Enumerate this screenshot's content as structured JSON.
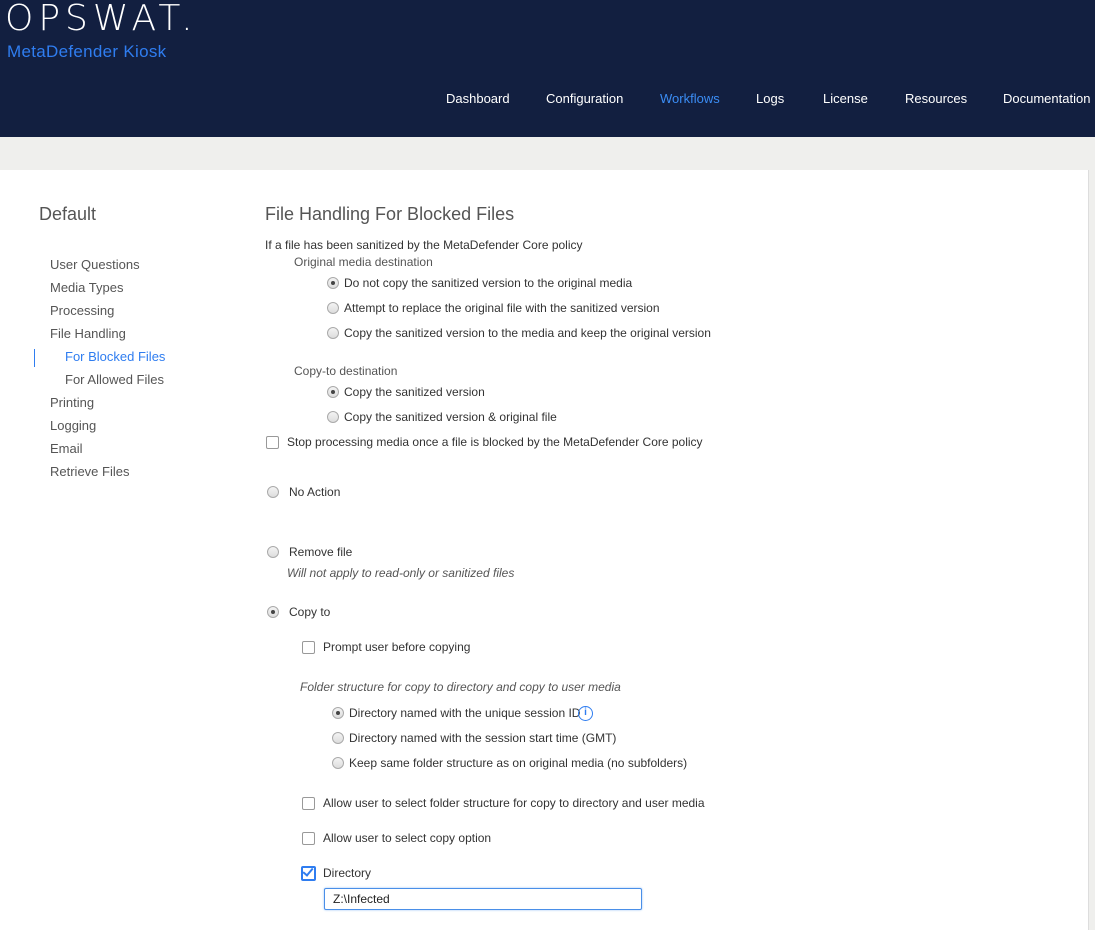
{
  "header": {
    "logo": "OPSWAT.",
    "product": "MetaDefender Kiosk",
    "nav": [
      "Dashboard",
      "Configuration",
      "Workflows",
      "Logs",
      "License",
      "Resources",
      "Documentation"
    ],
    "active_nav": "Workflows"
  },
  "sidebar": {
    "title": "Default",
    "items": [
      "User Questions",
      "Media Types",
      "Processing",
      "File Handling",
      "For Blocked Files",
      "For Allowed Files",
      "Printing",
      "Logging",
      "Email",
      "Retrieve Files"
    ],
    "active": "For Blocked Files"
  },
  "main": {
    "title": "File Handling For Blocked Files",
    "sanitized_intro": "If a file has been sanitized by the MetaDefender Core policy",
    "original_media_label": "Original media destination",
    "original_media_options": [
      "Do not copy the sanitized version to the original media",
      "Attempt to replace the original file with the sanitized version",
      "Copy the sanitized version to the media and keep the original version"
    ],
    "copy_to_label": "Copy-to destination",
    "copy_to_options": [
      "Copy the sanitized version",
      "Copy the sanitized version & original file"
    ],
    "stop_processing": "Stop processing media once a file is blocked by the MetaDefender Core policy",
    "no_action": "No Action",
    "remove_file": "Remove file",
    "remove_note": "Will not apply to read-only or sanitized files",
    "copy_to": "Copy to",
    "prompt_user": "Prompt user before copying",
    "folder_structure_label": "Folder structure for copy to directory and copy to user media",
    "folder_options": [
      "Directory named with the unique session ID",
      "Directory named with the session start time (GMT)",
      "Keep same folder structure as on original media (no subfolders)"
    ],
    "info_glyph": "i",
    "allow_folder": "Allow user to select folder structure for copy to directory and user media",
    "allow_copy_option": "Allow user to select copy option",
    "directory_label": "Directory",
    "directory_value": "Z:\\Infected"
  }
}
